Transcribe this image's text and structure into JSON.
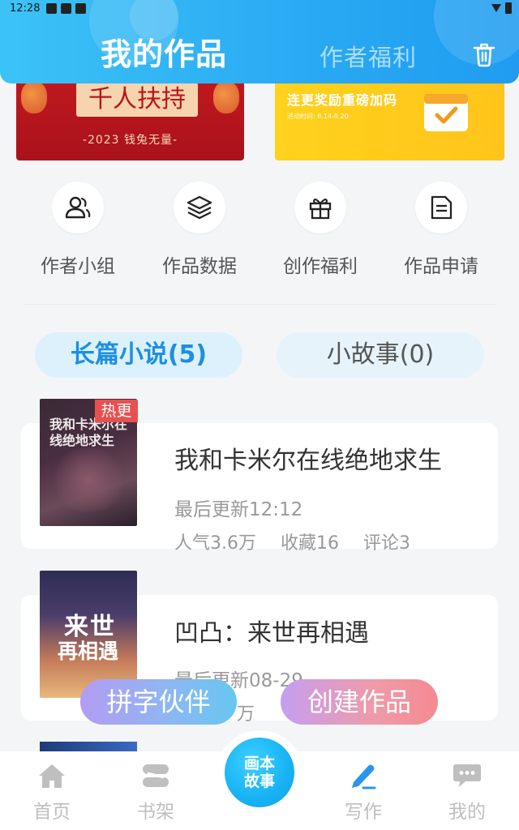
{
  "status_bar": {
    "time": "12:28"
  },
  "header": {
    "tab_active": "我的作品",
    "tab_inactive": "作者福利",
    "trash_icon": "trash-icon"
  },
  "banners": {
    "left": {
      "headline": "千人扶持",
      "subline": "-2023 钱兔无量-"
    },
    "right": {
      "headline": "连更奖励重磅加码",
      "date": "活动时间: 8.14-8.20"
    }
  },
  "quick_actions": [
    {
      "label": "作者小组",
      "icon": "users-icon"
    },
    {
      "label": "作品数据",
      "icon": "layers-icon"
    },
    {
      "label": "创作福利",
      "icon": "gift-icon"
    },
    {
      "label": "作品申请",
      "icon": "document-icon"
    }
  ],
  "tabs": {
    "long": "长篇小说(5)",
    "short": "小故事(0)"
  },
  "books": [
    {
      "title": "我和卡米尔在线绝地求生",
      "cover_text": "我和卡米尔在线绝地求生",
      "badge": "热更",
      "last_update": "最后更新12:12",
      "popularity": "人气3.6万",
      "favorites": "收藏16",
      "comments": "评论3"
    },
    {
      "title": "凹凸：来世再相遇",
      "cover_text_1": "来世",
      "cover_text_2": "再相遇",
      "last_update": "最后更新08-29",
      "popularity_fragment": "万"
    }
  ],
  "floating_buttons": {
    "left": "拼字伙伴",
    "right": "创建作品"
  },
  "bottom_nav": [
    {
      "label": "首页",
      "icon": "home-icon"
    },
    {
      "label": "书架",
      "icon": "bookshelf-icon"
    },
    {
      "label": "画本故事",
      "icon": "center-story-button"
    },
    {
      "label": "写作",
      "icon": "pen-icon"
    },
    {
      "label": "我的",
      "icon": "chat-bubble-icon"
    }
  ],
  "colors": {
    "header_start": "#3cc3f6",
    "header_end": "#1f9cf0",
    "accent_blue": "#2a95ef",
    "badge_red": "#e8504f"
  }
}
